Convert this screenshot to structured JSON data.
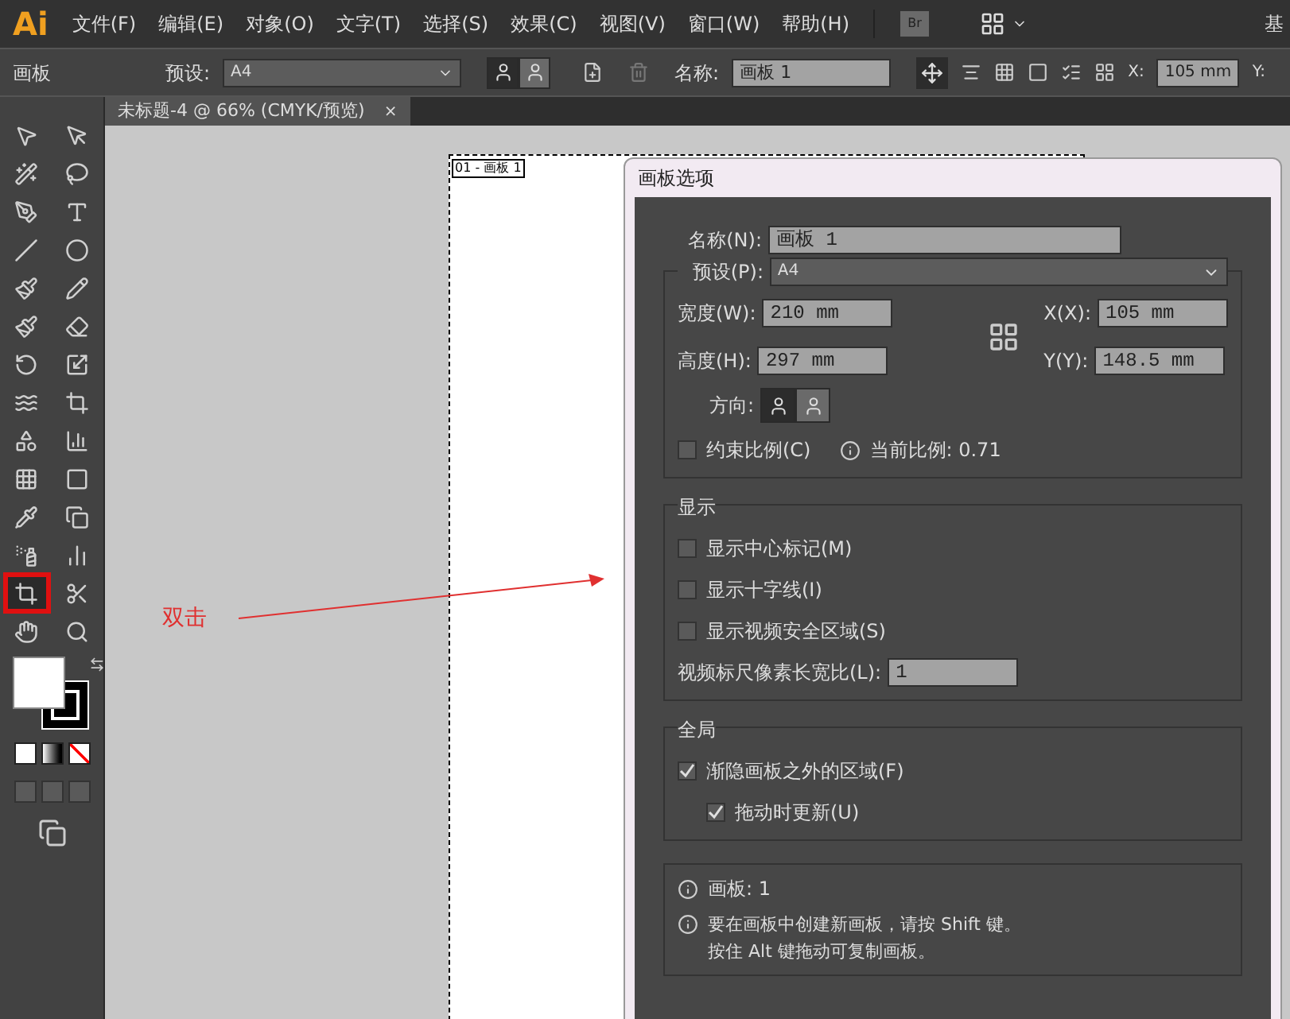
{
  "menubar": {
    "logo": "Ai",
    "menus": [
      "文件(F)",
      "编辑(E)",
      "对象(O)",
      "文字(T)",
      "选择(S)",
      "效果(C)",
      "视图(V)",
      "窗口(W)",
      "帮助(H)"
    ],
    "bridge": "Br",
    "workspace": "基"
  },
  "control_bar": {
    "label": "画板",
    "preset_label": "预设:",
    "preset_value": "A4",
    "orientation": [
      {
        "selected": true
      },
      {
        "selected": false
      }
    ],
    "name_label": "名称:",
    "name_value": "画板 1",
    "x_label": "X:",
    "x_value": "105 mm",
    "y_label": "Y:"
  },
  "document_tab": {
    "title": "未标题-4 @ 66% (CMYK/预览)",
    "close": "×"
  },
  "toolbar": {
    "tools": [
      {
        "kind": "select",
        "marked": false
      },
      {
        "kind": "direct",
        "marked": false
      },
      {
        "kind": "wand",
        "marked": false
      },
      {
        "kind": "lasso",
        "marked": false
      },
      {
        "kind": "pen",
        "marked": false
      },
      {
        "kind": "type",
        "marked": false
      },
      {
        "kind": "line",
        "marked": false
      },
      {
        "kind": "ellipse",
        "marked": false
      },
      {
        "kind": "brush",
        "marked": false
      },
      {
        "kind": "pencil",
        "marked": false
      },
      {
        "kind": "blob",
        "marked": false
      },
      {
        "kind": "eraser",
        "marked": false
      },
      {
        "kind": "rotate",
        "marked": false
      },
      {
        "kind": "scale",
        "marked": false
      },
      {
        "kind": "warp",
        "marked": false
      },
      {
        "kind": "transform",
        "marked": false
      },
      {
        "kind": "shape",
        "marked": false
      },
      {
        "kind": "graph3",
        "marked": false
      },
      {
        "kind": "mesh",
        "marked": false
      },
      {
        "kind": "gradient",
        "marked": false
      },
      {
        "kind": "eyedropper",
        "marked": false
      },
      {
        "kind": "blend",
        "marked": false
      },
      {
        "kind": "spray",
        "marked": false
      },
      {
        "kind": "chart",
        "marked": false
      },
      {
        "kind": "artboard",
        "marked": true
      },
      {
        "kind": "slice",
        "marked": false
      },
      {
        "kind": "hand",
        "marked": false
      },
      {
        "kind": "zoom",
        "marked": false
      }
    ]
  },
  "canvas": {
    "artboard_label": "01 - 画板 1",
    "annotation": "双击"
  },
  "dialog": {
    "title": "画板选项",
    "name_label": "名称(N):",
    "name_value": "画板 1",
    "preset_label": "预设(P):",
    "preset_value": "A4",
    "width_label": "宽度(W):",
    "width_value": "210 mm",
    "height_label": "高度(H):",
    "height_value": "297 mm",
    "x_label": "X(X):",
    "x_value": "105 mm",
    "y_label": "Y(Y):",
    "y_value": "148.5 mm",
    "orientation_label": "方向:",
    "orientation": [
      {
        "selected": true
      },
      {
        "selected": false
      }
    ],
    "constrain": {
      "label": "约束比例(C)",
      "checked": false
    },
    "current_ratio": "当前比例: 0.71",
    "display": {
      "title": "显示",
      "options": [
        {
          "label": "显示中心标记(M)",
          "checked": false
        },
        {
          "label": "显示十字线(I)",
          "checked": false
        },
        {
          "label": "显示视频安全区域(S)",
          "checked": false
        }
      ],
      "pixel_ratio_label": "视频标尺像素长宽比(L):",
      "pixel_ratio_value": "1"
    },
    "global": {
      "title": "全局",
      "options": [
        {
          "label": "渐隐画板之外的区域(F)",
          "checked": true,
          "children": [
            {
              "label": "拖动时更新(U)",
              "checked": true
            }
          ]
        }
      ]
    },
    "info": {
      "artboards": "画板: 1",
      "hint": [
        "要在画板中创建新画板，请按 Shift 键。",
        "按住 Alt 键拖动可复制画板。"
      ]
    }
  }
}
